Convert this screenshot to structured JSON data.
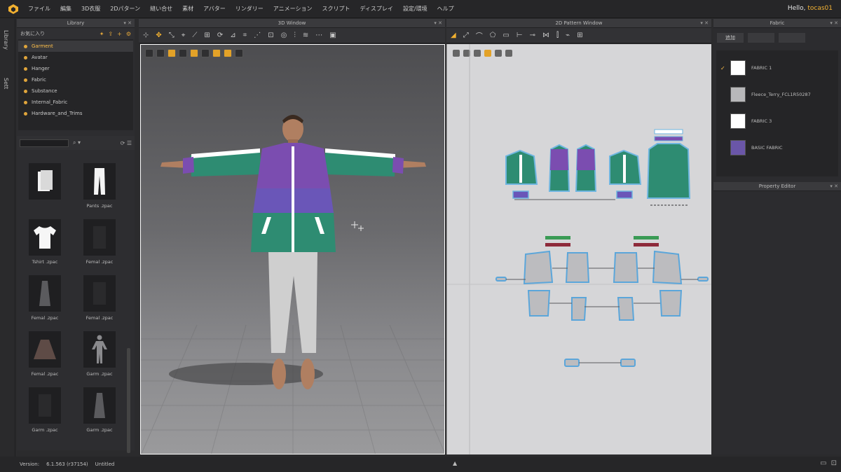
{
  "menu": {
    "items": [
      "ファイル",
      "編集",
      "3D衣服",
      "2Dパターン",
      "縫い合せ",
      "素材",
      "アバター",
      "リンダリー",
      "アニメーション",
      "スクリプト",
      "ディスプレイ",
      "設定/環境",
      "ヘルプ"
    ],
    "greeting_prefix": "Hello, ",
    "user": "tocas01"
  },
  "left_rail": {
    "tab1": "Library",
    "tab2": "Sett"
  },
  "library": {
    "title": "Library",
    "favorites_label": "お気に入り",
    "folders": [
      {
        "label": "Garment",
        "selected": true
      },
      {
        "label": "Avatar",
        "selected": false
      },
      {
        "label": "Hanger",
        "selected": false
      },
      {
        "label": "Fabric",
        "selected": false
      },
      {
        "label": "Substance",
        "selected": false
      },
      {
        "label": "Internal_Fabric",
        "selected": false
      },
      {
        "label": "Hardware_and_Trims",
        "selected": false
      }
    ],
    "thumbnails": [
      {
        "label": "",
        "icon": "folder-icon"
      },
      {
        "label": "Pants .zpac",
        "icon": "pants-icon"
      },
      {
        "label": "Tshirt .zpac",
        "icon": "tshirt-icon"
      },
      {
        "label": "Femal .zpac",
        "icon": "garment-dark-icon"
      },
      {
        "label": "Femal .zpac",
        "icon": "dress-icon"
      },
      {
        "label": "Femal .zpac",
        "icon": "garment-dark-icon"
      },
      {
        "label": "Femal .zpac",
        "icon": "skirt-icon"
      },
      {
        "label": "Garm .zpac",
        "icon": "avatar-icon"
      },
      {
        "label": "Garm .zpac",
        "icon": "garment-dark-icon"
      },
      {
        "label": "Garm .zpac",
        "icon": "dress-icon"
      }
    ]
  },
  "window3d": {
    "title": "3D Window"
  },
  "window2d": {
    "title": "2D Pattern Window"
  },
  "fabric_panel": {
    "title": "Fabric",
    "tabs": [
      "追加",
      "",
      ""
    ],
    "items": [
      {
        "label": "FABRIC 1",
        "color": "#ffffff",
        "checked": true
      },
      {
        "label": "Fleece_Terry_FCL1R50287",
        "color": "#b8b8ba",
        "checked": false
      },
      {
        "label": "FABRIC 3",
        "color": "#ffffff",
        "checked": false
      },
      {
        "label": "BASIC FABRIC",
        "color": "#6a56a8",
        "checked": false
      }
    ]
  },
  "property_editor": {
    "title": "Property Editor"
  },
  "status": {
    "version_label": "Version:",
    "version": "6.1.563 (r37154)",
    "file": "Untitled"
  },
  "colors": {
    "accent": "#f1b030",
    "jacket_green": "#2e8c72",
    "jacket_purple": "#7b4db0",
    "pattern_bg": "#d6d6d8"
  }
}
